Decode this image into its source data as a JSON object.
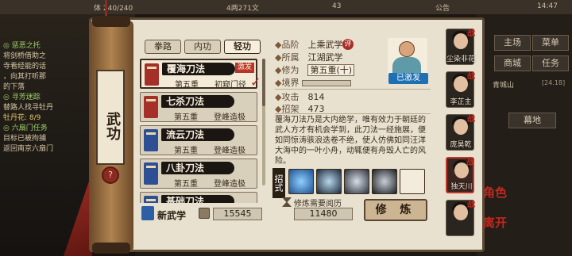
{
  "topbar": {
    "res1": "体 240/240",
    "res2": "4两271文",
    "res3": "43",
    "notice": "公告",
    "time": "14:47"
  },
  "quests": [
    {
      "title": "◎ 惩恶之托",
      "cls": "green",
      "lines": [
        "将剑桥借助之",
        "寺看经能的话",
        "，向其打听那",
        "的下落"
      ]
    },
    {
      "title": "◎ 寻芳迷踪",
      "cls": "green",
      "lines": [
        "替路人找寻牡丹",
        "牡丹花: 8/9"
      ]
    },
    {
      "title": "◎ 六扇门任务",
      "cls": "green",
      "lines": [
        "目标已被拘捕",
        "返回南京六扇门"
      ]
    }
  ],
  "right_menu": {
    "btn1": "主场",
    "btn2": "菜单",
    "btn3": "商城",
    "btn4": "任务",
    "location": "青城山",
    "level_hint": "[24.18]",
    "region": "幕地"
  },
  "scroll_title": "武功",
  "knot": "?",
  "tabs": [
    {
      "label": "拳路",
      "active": false
    },
    {
      "label": "内功",
      "active": false
    },
    {
      "label": "轻功",
      "active": true
    }
  ],
  "skills": [
    {
      "name": "覆海刀法",
      "level": "第五重",
      "status": "初窥门径",
      "badge": "激发",
      "book": "red",
      "selected": true
    },
    {
      "name": "七杀刀法",
      "level": "第五重",
      "status": "登峰造极",
      "badge": "",
      "book": "red",
      "selected": false
    },
    {
      "name": "流云刀法",
      "level": "第五重",
      "status": "登峰造极",
      "badge": "",
      "book": "blue",
      "selected": false
    },
    {
      "name": "八卦刀法",
      "level": "第五重",
      "status": "登峰造极",
      "badge": "",
      "book": "blue",
      "selected": false
    },
    {
      "name": "基础刀法",
      "level": "",
      "status": "",
      "badge": "",
      "book": "blue",
      "selected": false
    }
  ],
  "new_skill_label": "新武学",
  "currency1": "15545",
  "currency2": "11480",
  "train_need_label": "修炼需要阅历",
  "details": {
    "rank_k": "品阶",
    "rank_v": "上乘武学",
    "ping": "评",
    "faction_k": "所属",
    "faction_v": "江湖武学",
    "cultivation_k": "修为",
    "cultivation_v": "第五重(十)",
    "realm_k": "境界",
    "attack_k": "攻击",
    "attack_v": "814",
    "parry_k": "招架",
    "parry_v": "473"
  },
  "learned_label": "已激发",
  "description": "覆海刀法乃是大内绝学，唯有效力于朝廷的武人方才有机会学到，此刀法一经施展，便如同惊涛骇浪迭卷不绝，使人仿佛如同汪洋大海中的一叶小舟，动辄便有舟毁人亡的风险。",
  "moves_label": "招式",
  "train_button": "修 炼",
  "companions": [
    {
      "name": "尘染非花",
      "selected": false
    },
    {
      "name": "李芷主",
      "selected": false
    },
    {
      "name": "庞昊乾",
      "selected": false
    },
    {
      "name": "独天川",
      "selected": true
    },
    {
      "name": "",
      "selected": false
    }
  ],
  "seals": {
    "s1": "角色",
    "s2": "离开"
  }
}
